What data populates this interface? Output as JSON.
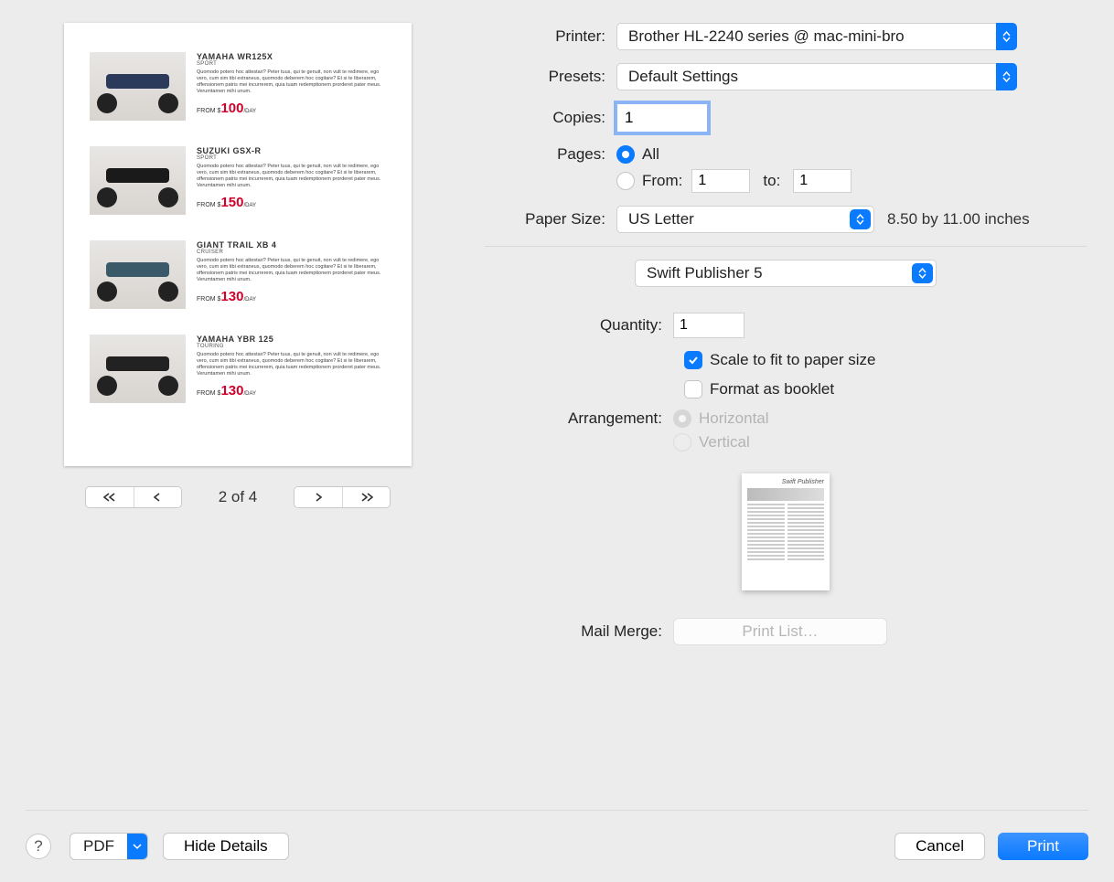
{
  "labels": {
    "printer": "Printer:",
    "presets": "Presets:",
    "copies": "Copies:",
    "pages": "Pages:",
    "from": "From:",
    "to": "to:",
    "paperSize": "Paper Size:",
    "quantity": "Quantity:",
    "scaleToFit": "Scale to fit to paper size",
    "formatBooklet": "Format as booklet",
    "arrangement": "Arrangement:",
    "horizontal": "Horizontal",
    "vertical": "Vertical",
    "mailMerge": "Mail Merge:",
    "all": "All"
  },
  "values": {
    "printer": "Brother HL-2240 series @ mac-mini-bro",
    "presets": "Default Settings",
    "copies": "1",
    "pagesMode": "all",
    "from": "1",
    "to": "1",
    "paperSize": "US Letter",
    "paperNote": "8.50 by 11.00 inches",
    "appMenu": "Swift Publisher 5",
    "quantity": "1",
    "scaleToFit": true,
    "formatBooklet": false,
    "arrangement": "horizontal",
    "arrangementEnabled": false
  },
  "preview": {
    "pageIndicator": "2 of 4",
    "thumbTitle": "Swift Publisher",
    "products": [
      {
        "name": "YAMAHA WR125X",
        "category": "SPORT",
        "desc": "Quomodo potero hoc attestari? Peter tuus, qui te genuit, non vult te redimere, ego vero, cum sim tibi extraneus, quomodo deberem hoc cogitare? Et si te liberarem, offensionem patris mei incurrerem, quia tuam redemptionem prorderet pater meus. Verumtamen mihi unum.",
        "price": "100"
      },
      {
        "name": "SUZUKI GSX-R",
        "category": "SPORT",
        "desc": "Quomodo potero hoc attestari? Peter tuus, qui te genuit, non vult te redimere, ego vero, cum sim tibi extraneus, quomodo deberem hoc cogitare? Et si te liberarem, offensionem patris mei incurrerem, quia tuam redemptionem prorderet pater meus. Verumtamen mihi unum.",
        "price": "150"
      },
      {
        "name": "GIANT TRAIL XB 4",
        "category": "CRUISER",
        "desc": "Quomodo potero hoc attestari? Peter tuus, qui te genuit, non vult te redimere, ego vero, cum sim tibi extraneus, quomodo deberem hoc cogitare? Et si te liberarem, offensionem patris mei incurrerem, quia tuam redemptionem prorderet pater meus. Verumtamen mihi unum.",
        "price": "130"
      },
      {
        "name": "YAMAHA YBR 125",
        "category": "TOURING",
        "desc": "Quomodo potero hoc attestari? Peter tuus, qui te genuit, non vult te redimere, ego vero, cum sim tibi extraneus, quomodo deberem hoc cogitare? Et si te liberarem, offensionem patris mei incurrerem, quia tuam redemptionem prorderet pater meus. Verumtamen mihi unum.",
        "price": "130"
      }
    ],
    "priceFromPrefix": "FROM $",
    "priceSuffix": "/DAY"
  },
  "buttons": {
    "printList": "Print List…",
    "pdf": "PDF",
    "hideDetails": "Hide Details",
    "cancel": "Cancel",
    "print": "Print",
    "help": "?",
    "first": "⟨⟨",
    "prev": "⟨",
    "next": "⟩",
    "last": "⟩⟩"
  }
}
